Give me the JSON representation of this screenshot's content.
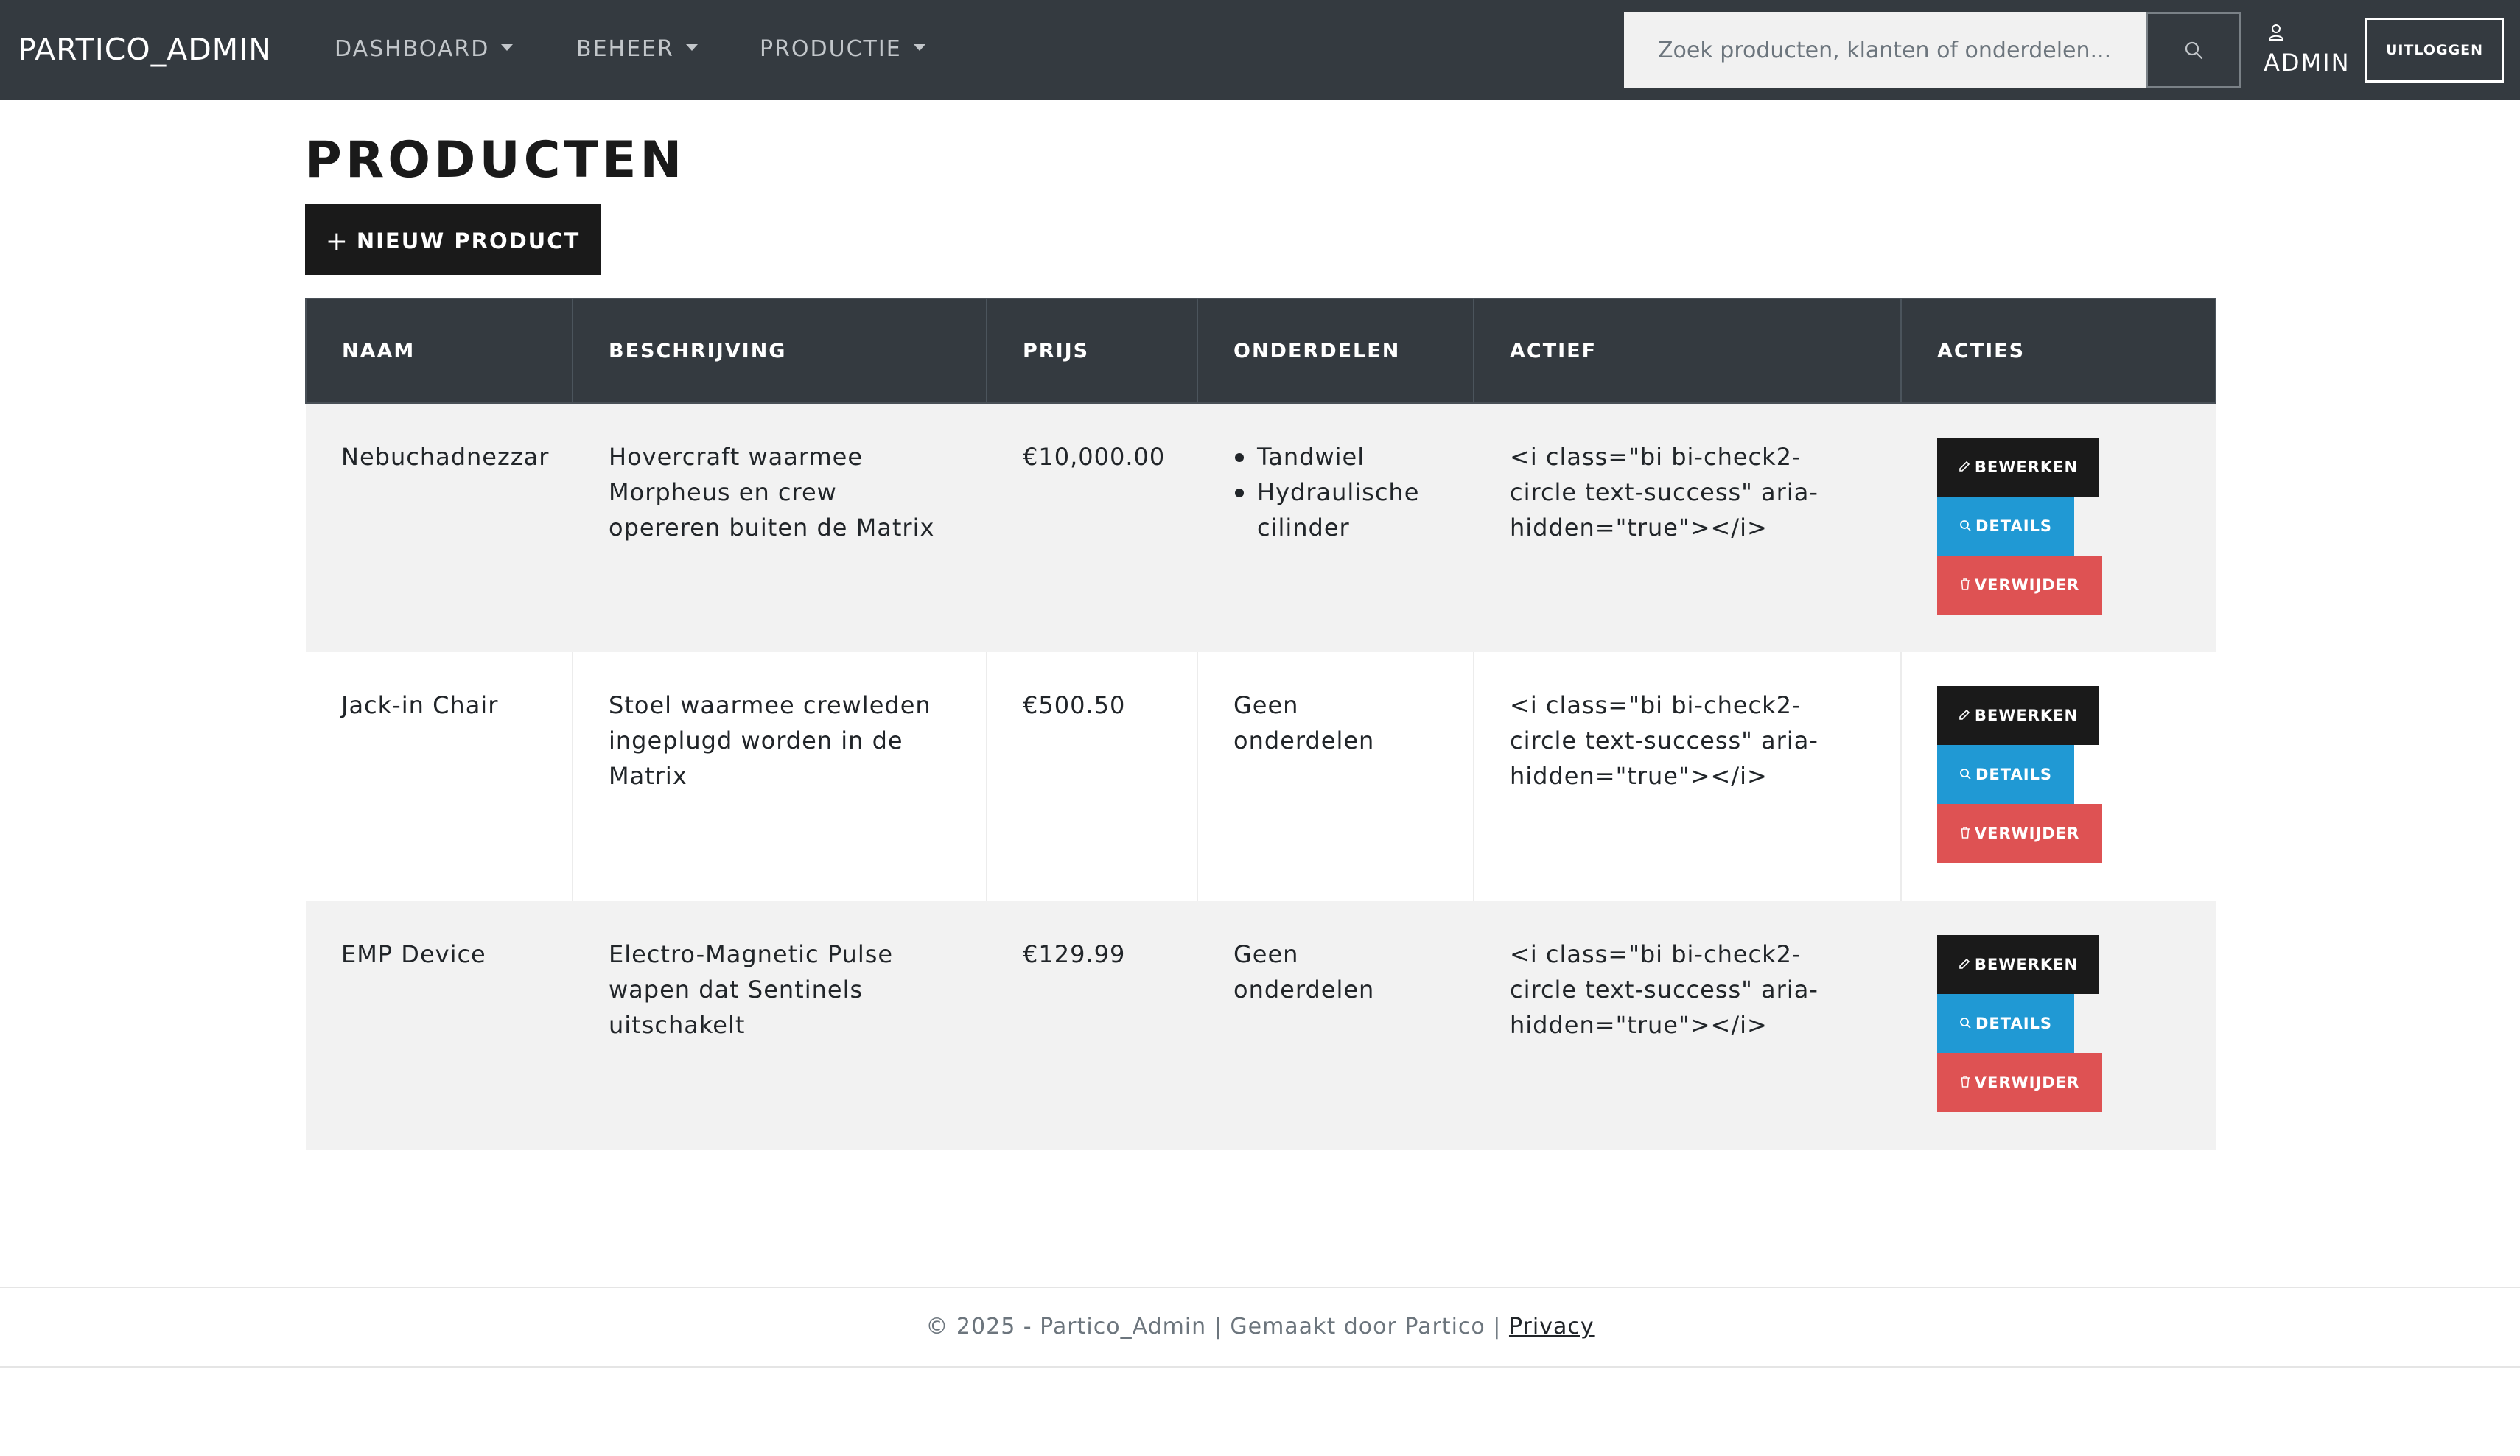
{
  "navbar": {
    "brand": "PARTICO_ADMIN",
    "items": [
      {
        "label": "DASHBOARD"
      },
      {
        "label": "BEHEER"
      },
      {
        "label": "PRODUCTIE"
      }
    ],
    "search": {
      "placeholder": "Zoek producten, klanten of onderdelen...",
      "value": ""
    },
    "search_icon": "search-icon",
    "user_icon": "person-icon",
    "user_name": "ADMIN",
    "logout_label": "UITLOGGEN"
  },
  "main": {
    "title": "PRODUCTEN",
    "new_button": {
      "icon": "plus-icon",
      "label": "NIEUW PRODUCT"
    },
    "table": {
      "headers": [
        "NAAM",
        "BESCHRIJVING",
        "PRIJS",
        "ONDERDELEN",
        "ACTIEF",
        "ACTIES"
      ],
      "rows": [
        {
          "name": "Nebuchadnezzar",
          "description": "Hovercraft waarmee Morpheus en crew opereren buiten de Matrix",
          "price": "€10,000.00",
          "parts": [
            "Tandwiel",
            "Hydraulische cilinder"
          ],
          "no_parts": "",
          "active": "<i class=\"bi bi-check2-circle text-success\" aria-hidden=\"true\"></i>"
        },
        {
          "name": "Jack-in Chair",
          "description": "Stoel waarmee crewleden ingeplugd worden in de Matrix",
          "price": "€500.50",
          "parts": [],
          "no_parts": "Geen onderdelen",
          "active": "<i class=\"bi bi-check2-circle text-success\" aria-hidden=\"true\"></i>"
        },
        {
          "name": "EMP Device",
          "description": "Electro-Magnetic Pulse wapen dat Sentinels uitschakelt",
          "price": "€129.99",
          "parts": [],
          "no_parts": "Geen onderdelen",
          "active": "<i class=\"bi bi-check2-circle text-success\" aria-hidden=\"true\"></i>"
        }
      ],
      "actions": {
        "edit": "BEWERKEN",
        "details": "DETAILS",
        "delete": "VERWIJDER"
      }
    }
  },
  "footer": {
    "text": "© 2025 - Partico_Admin | Gemaakt door Partico |",
    "privacy_label": "Privacy"
  },
  "colors": {
    "navbar_bg": "#343a40",
    "dark_button": "#1a1a1a",
    "details_button": "#2099d4",
    "delete_button": "#de5253"
  }
}
